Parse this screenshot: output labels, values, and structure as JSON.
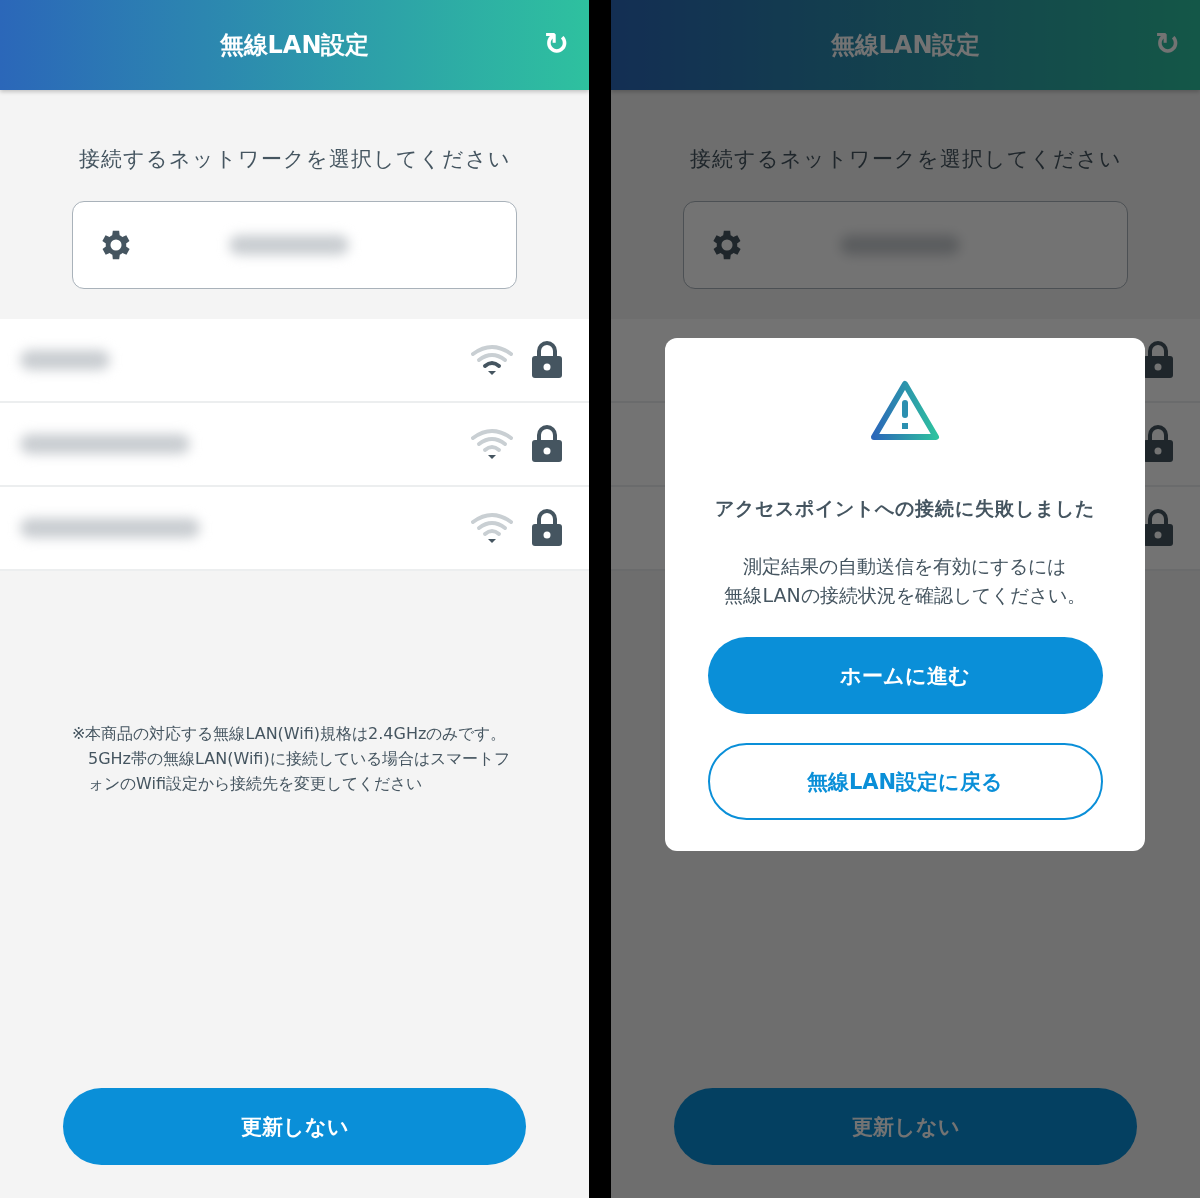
{
  "screens": [
    {
      "header": {
        "title": "無線LAN設定",
        "refresh_icon": "↻"
      },
      "subtitle": "接続するネットワークを選択してください",
      "settings_card": {
        "name_hidden": true
      },
      "networks": [
        {
          "name_hidden": true,
          "kind": "medium",
          "secured": true
        },
        {
          "name_hidden": true,
          "kind": "weak",
          "secured": true
        },
        {
          "name_hidden": true,
          "kind": "weak",
          "secured": true
        }
      ],
      "note": "※本商品の対応する無線LAN(Wifi)規格は2.4GHzのみです。5GHz帯の無線LAN(Wifi)に接続している場合はスマートフォンのWifi設定から接続先を変更してください",
      "button": "更新しない"
    },
    {
      "header": {
        "title": "無線LAN設定",
        "refresh_icon": "↻"
      },
      "subtitle": "接続するネットワークを選択してください",
      "settings_card": {
        "name_hidden": true
      },
      "networks": [
        {
          "secured": true
        },
        {
          "secured": true
        },
        {
          "secured": true
        }
      ],
      "button": "更新しない",
      "dialog": {
        "title": "アクセスポイントへの接続に失敗しました",
        "message_lines": [
          "測定結果の自動送信を有効にするには",
          "無線LANの接続状況を確認してください。"
        ],
        "primary_button": "ホームに進む",
        "secondary_button": "無線LAN設定に戻る"
      }
    }
  ]
}
